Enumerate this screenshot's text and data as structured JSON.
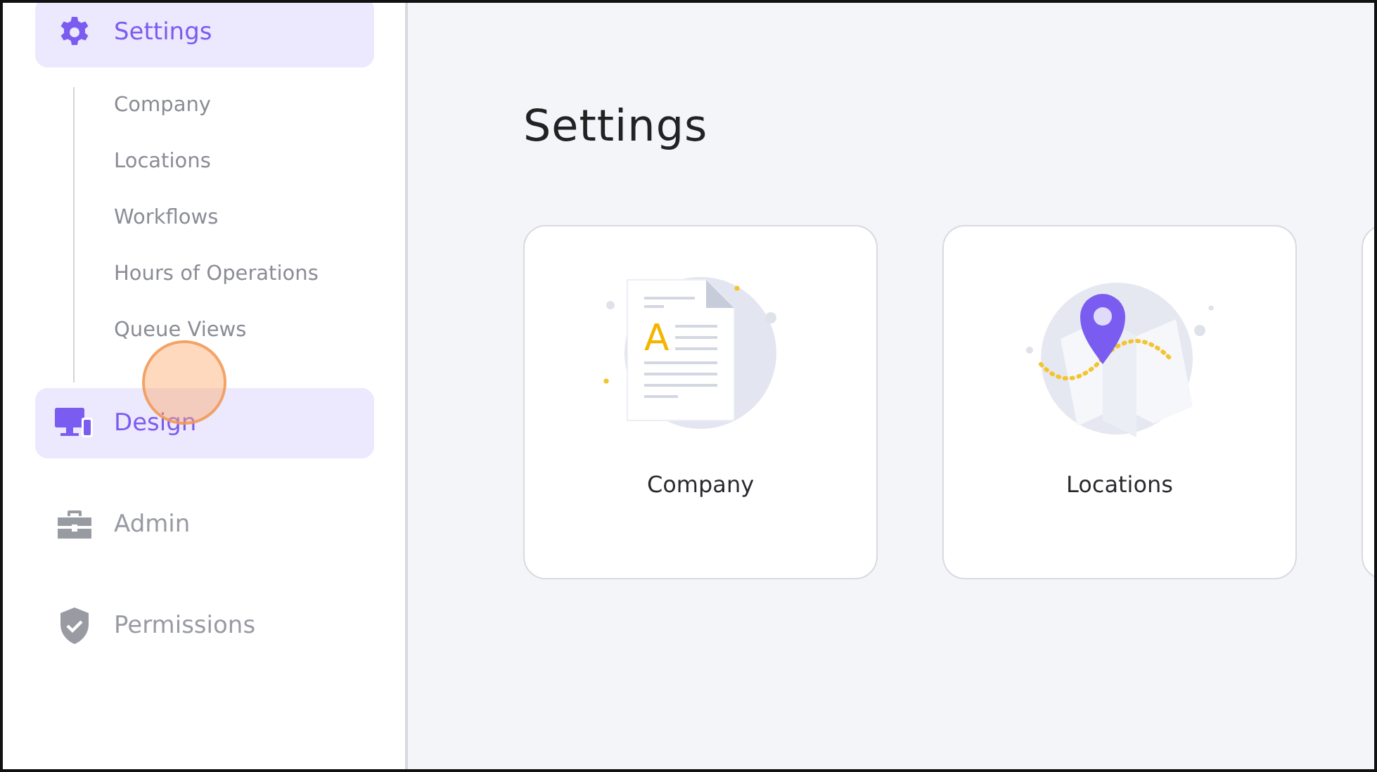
{
  "sidebar": {
    "items": [
      {
        "kind": "settings",
        "label": "Settings",
        "selected": true,
        "children": [
          {
            "label": "Company"
          },
          {
            "label": "Locations"
          },
          {
            "label": "Workflows"
          },
          {
            "label": "Hours of Operations"
          },
          {
            "label": "Queue Views"
          }
        ]
      },
      {
        "kind": "design",
        "label": "Design",
        "selected": true
      },
      {
        "kind": "admin",
        "label": "Admin",
        "selected": false
      },
      {
        "kind": "permissions",
        "label": "Permissions",
        "selected": false
      }
    ]
  },
  "page_title": "Settings",
  "cards": [
    {
      "kind": "document",
      "label": "Company",
      "illustration_letter": "A"
    },
    {
      "kind": "map",
      "label": "Locations"
    },
    {
      "kind": "partial"
    }
  ]
}
